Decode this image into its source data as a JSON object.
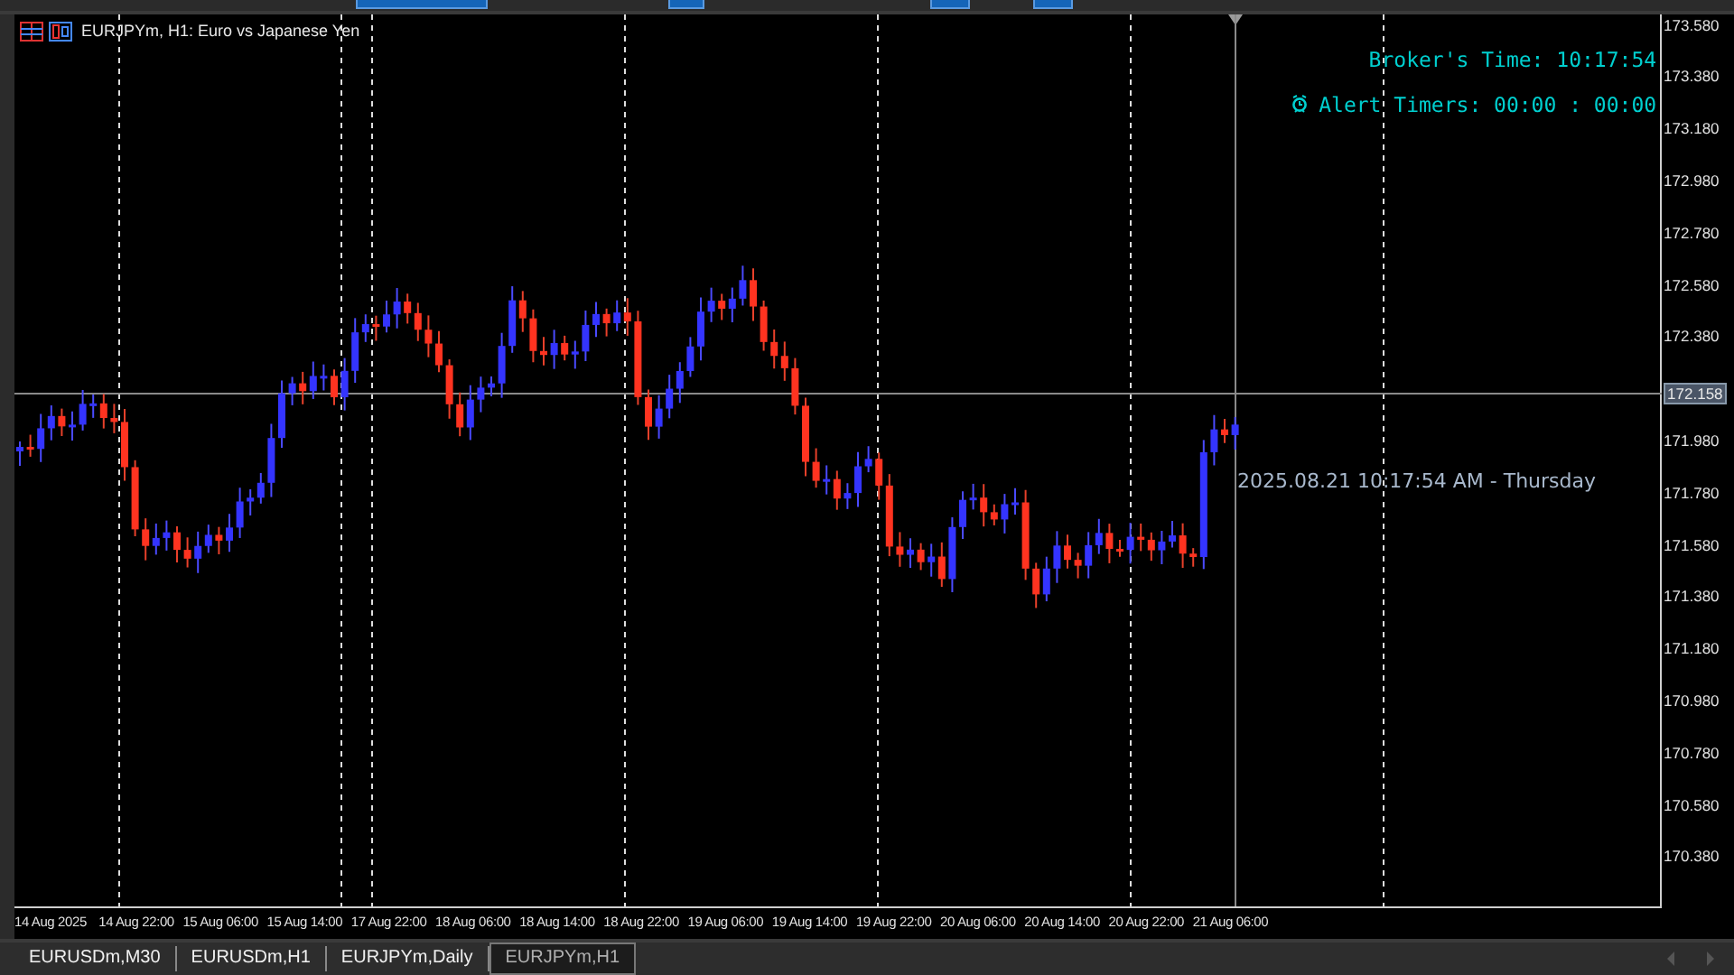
{
  "chart": {
    "title": "EURJPYm, H1:  Euro vs Japanese Yen",
    "broker_time": "Broker's Time: 10:17:54",
    "alert_timers": "Alert Timers: 00:00 : 00:00",
    "cursor_time": "2025.08.21 10:17:54 AM - Thursday",
    "current_price": "172.158"
  },
  "price_axis": [
    "173.580",
    "173.380",
    "173.180",
    "172.980",
    "172.780",
    "172.580",
    "172.380",
    "171.980",
    "171.780",
    "171.580",
    "171.380",
    "171.180",
    "170.980",
    "170.780",
    "170.580",
    "170.380"
  ],
  "time_axis": [
    "14 Aug 2025",
    "14 Aug 22:00",
    "15 Aug 06:00",
    "15 Aug 14:00",
    "17 Aug 22:00",
    "18 Aug 06:00",
    "18 Aug 14:00",
    "18 Aug 22:00",
    "19 Aug 06:00",
    "19 Aug 14:00",
    "19 Aug 22:00",
    "20 Aug 06:00",
    "20 Aug 14:00",
    "20 Aug 22:00",
    "21 Aug 06:00"
  ],
  "tabs": [
    {
      "label": "EURUSDm,M30",
      "selected": false
    },
    {
      "label": "EURUSDm,H1",
      "selected": false
    },
    {
      "label": "EURJPYm,Daily",
      "selected": false
    },
    {
      "label": "EURJPYm,H1",
      "selected": true
    }
  ]
}
